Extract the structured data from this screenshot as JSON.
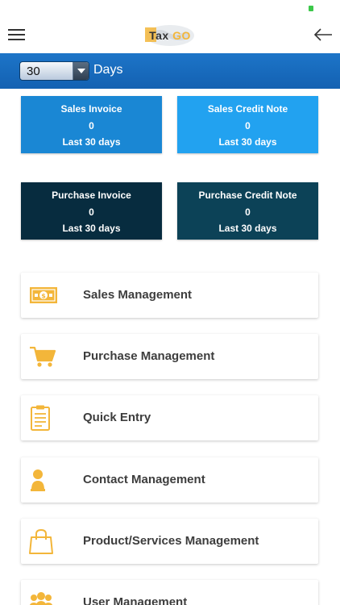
{
  "header": {
    "logo": {
      "part1": "Tax",
      "part2": "GO"
    }
  },
  "days_filter": {
    "selected": "30",
    "label": "Days"
  },
  "cards": [
    {
      "title": "Sales Invoice",
      "value": "0",
      "period": "Last 30 days",
      "color": "#1a87d4"
    },
    {
      "title": "Sales Credit Note",
      "value": "0",
      "period": "Last 30 days",
      "color": "#22a2f0"
    },
    {
      "title": "Purchase Invoice",
      "value": "0",
      "period": "Last 30 days",
      "color": "#072c3f"
    },
    {
      "title": "Purchase Credit Note",
      "value": "0",
      "period": "Last 30 days",
      "color": "#0c4257"
    }
  ],
  "menu": [
    {
      "label": "Sales Management",
      "icon": "money-icon"
    },
    {
      "label": "Purchase Management",
      "icon": "cart-icon"
    },
    {
      "label": "Quick Entry",
      "icon": "clipboard-icon"
    },
    {
      "label": "Contact Management",
      "icon": "person-icon"
    },
    {
      "label": "Product/Services Management",
      "icon": "shopping-bag-icon"
    },
    {
      "label": "User Management",
      "icon": "users-icon"
    }
  ],
  "colors": {
    "accent_bar": "#1d75c8",
    "icon_yellow": "#f3b63a"
  }
}
